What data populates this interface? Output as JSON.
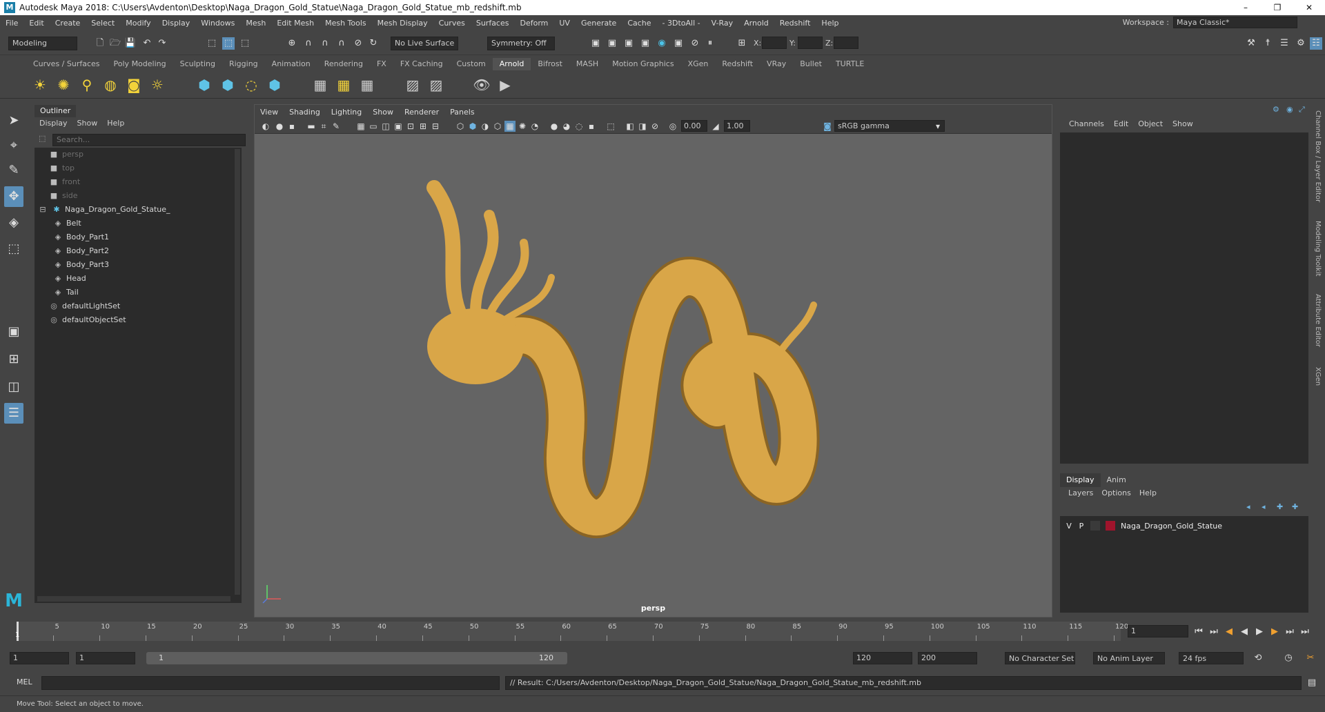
{
  "window": {
    "title": "Autodesk Maya 2018: C:\\Users\\Avdenton\\Desktop\\Naga_Dragon_Gold_Statue\\Naga_Dragon_Gold_Statue_mb_redshift.mb",
    "app_icon": "M",
    "minimize": "–",
    "maximize": "❐",
    "close": "✕"
  },
  "menubar": {
    "items": [
      "File",
      "Edit",
      "Create",
      "Select",
      "Modify",
      "Display",
      "Windows",
      "Mesh",
      "Edit Mesh",
      "Mesh Tools",
      "Mesh Display",
      "Curves",
      "Surfaces",
      "Deform",
      "UV",
      "Generate",
      "Cache",
      "- 3DtoAll -",
      "V-Ray",
      "Arnold",
      "Redshift",
      "Help"
    ],
    "workspace_label": "Workspace :",
    "workspace_value": "Maya Classic*"
  },
  "statusline": {
    "mode": "Modeling",
    "live_surface": "No Live Surface",
    "symmetry": "Symmetry: Off",
    "x_label": "X:",
    "y_label": "Y:",
    "z_label": "Z:"
  },
  "shelf": {
    "tabs": [
      "Curves / Surfaces",
      "Poly Modeling",
      "Sculpting",
      "Rigging",
      "Animation",
      "Rendering",
      "FX",
      "FX Caching",
      "Custom",
      "Arnold",
      "Bifrost",
      "MASH",
      "Motion Graphics",
      "XGen",
      "Redshift",
      "VRay",
      "Bullet",
      "TURTLE"
    ],
    "active_tab": "Arnold"
  },
  "outliner": {
    "tab": "Outliner",
    "menu": [
      "Display",
      "Show",
      "Help"
    ],
    "search_placeholder": "Search...",
    "nodes": [
      {
        "label": "persp",
        "dim": true,
        "indent": 0,
        "icon": "camera"
      },
      {
        "label": "top",
        "dim": true,
        "indent": 0,
        "icon": "camera"
      },
      {
        "label": "front",
        "dim": true,
        "indent": 0,
        "icon": "camera"
      },
      {
        "label": "side",
        "dim": true,
        "indent": 0,
        "icon": "camera"
      },
      {
        "label": "Naga_Dragon_Gold_Statue_",
        "dim": false,
        "indent": 0,
        "icon": "group"
      },
      {
        "label": "Belt",
        "dim": false,
        "indent": 1,
        "icon": "mesh"
      },
      {
        "label": "Body_Part1",
        "dim": false,
        "indent": 1,
        "icon": "mesh"
      },
      {
        "label": "Body_Part2",
        "dim": false,
        "indent": 1,
        "icon": "mesh"
      },
      {
        "label": "Body_Part3",
        "dim": false,
        "indent": 1,
        "icon": "mesh"
      },
      {
        "label": "Head",
        "dim": false,
        "indent": 1,
        "icon": "mesh"
      },
      {
        "label": "Tail",
        "dim": false,
        "indent": 1,
        "icon": "mesh"
      },
      {
        "label": "defaultLightSet",
        "dim": false,
        "indent": 0,
        "icon": "set"
      },
      {
        "label": "defaultObjectSet",
        "dim": false,
        "indent": 0,
        "icon": "set"
      }
    ]
  },
  "viewport": {
    "menu": [
      "View",
      "Shading",
      "Lighting",
      "Show",
      "Renderer",
      "Panels"
    ],
    "exposure": "0.00",
    "gamma_value": "1.00",
    "color_space": "sRGB gamma",
    "camera": "persp",
    "model_color": "#d9a648"
  },
  "channelbox": {
    "menu": [
      "Channels",
      "Edit",
      "Object",
      "Show"
    ],
    "layer_tabs": [
      "Display",
      "Anim"
    ],
    "active_layer_tab": "Display",
    "layer_menu": [
      "Layers",
      "Options",
      "Help"
    ],
    "layer": {
      "v": "V",
      "p": "P",
      "name": "Naga_Dragon_Gold_Statue",
      "color": "#a0142c"
    }
  },
  "sidetabs": [
    "Channel Box / Layer Editor",
    "Modeling Toolkit",
    "Attribute Editor",
    "XGen"
  ],
  "timeline": {
    "ticks": [
      "5",
      "10",
      "15",
      "20",
      "25",
      "30",
      "35",
      "40",
      "45",
      "50",
      "55",
      "60",
      "65",
      "70",
      "75",
      "80",
      "85",
      "90",
      "95",
      "100",
      "105",
      "110",
      "115",
      "120"
    ],
    "current_frame": "1",
    "frame_label": "1"
  },
  "range": {
    "start": "1",
    "playback_start": "1",
    "slider_start": "1",
    "slider_end": "120",
    "playback_end": "120",
    "end": "200",
    "character_set": "No Character Set",
    "anim_layer": "No Anim Layer",
    "fps": "24 fps"
  },
  "commandline": {
    "lang": "MEL",
    "result": "// Result: C:/Users/Avdenton/Desktop/Naga_Dragon_Gold_Statue/Naga_Dragon_Gold_Statue_mb_redshift.mb"
  },
  "helpline": {
    "text": "Move Tool: Select an object to move."
  }
}
